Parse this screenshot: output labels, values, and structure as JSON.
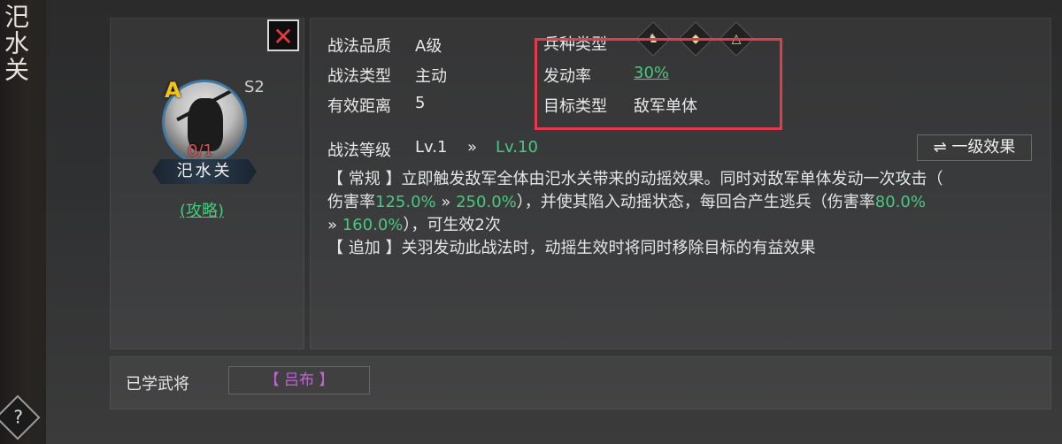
{
  "page": {
    "vertical_title": "汜水关",
    "help_icon": "?"
  },
  "close_button": {
    "icon": "close-icon",
    "glyph": "✕"
  },
  "card": {
    "grade": "A",
    "season": "S2",
    "count": "0/1",
    "name": "汜水关",
    "guide_link": "(攻略)"
  },
  "info": {
    "quality_label": "战法品质",
    "quality_value": "A级",
    "type_label": "战法类型",
    "type_value": "主动",
    "range_label": "有效距离",
    "range_value": "5",
    "troop_label": "兵种类型",
    "rate_label": "发动率",
    "rate_value": "30%",
    "target_label": "目标类型",
    "target_value": "敌军单体"
  },
  "troop_icons": [
    {
      "name": "cavalry-icon",
      "glyph": "♞"
    },
    {
      "name": "shield-icon",
      "glyph": "◆"
    },
    {
      "name": "bow-icon",
      "glyph": "△"
    }
  ],
  "level": {
    "label": "战法等级",
    "from": "Lv.1",
    "arrow": "»",
    "to": "Lv.10",
    "button": "⇌ 一级效果"
  },
  "description": {
    "line1_a": "【 常规 】立即触发敌军全体由汜水关带来的动摇效果。同时对敌军单体发动一次攻击（",
    "line2_a": "伤害率",
    "dmg_from": "125.0%",
    "arrow": " » ",
    "dmg_to": "250.0%",
    "line2_b": "），并使其陷入动摇状态，每回合产生逃兵（伤害率",
    "desert_from": "80.0%",
    "desert_arrow": "» ",
    "desert_to": "160.0%",
    "line3_b": "），可生效2次",
    "line4": "【 追加 】关羽发动此战法时，动摇生效时将同时移除目标的有益效果"
  },
  "learned": {
    "label": "已学武将",
    "general": "【 吕布 】"
  },
  "colors": {
    "accent_green": "#49c97e",
    "highlight_red": "#e33b4c",
    "grade_gold": "#f3c316",
    "general_purple": "#c063d8"
  }
}
